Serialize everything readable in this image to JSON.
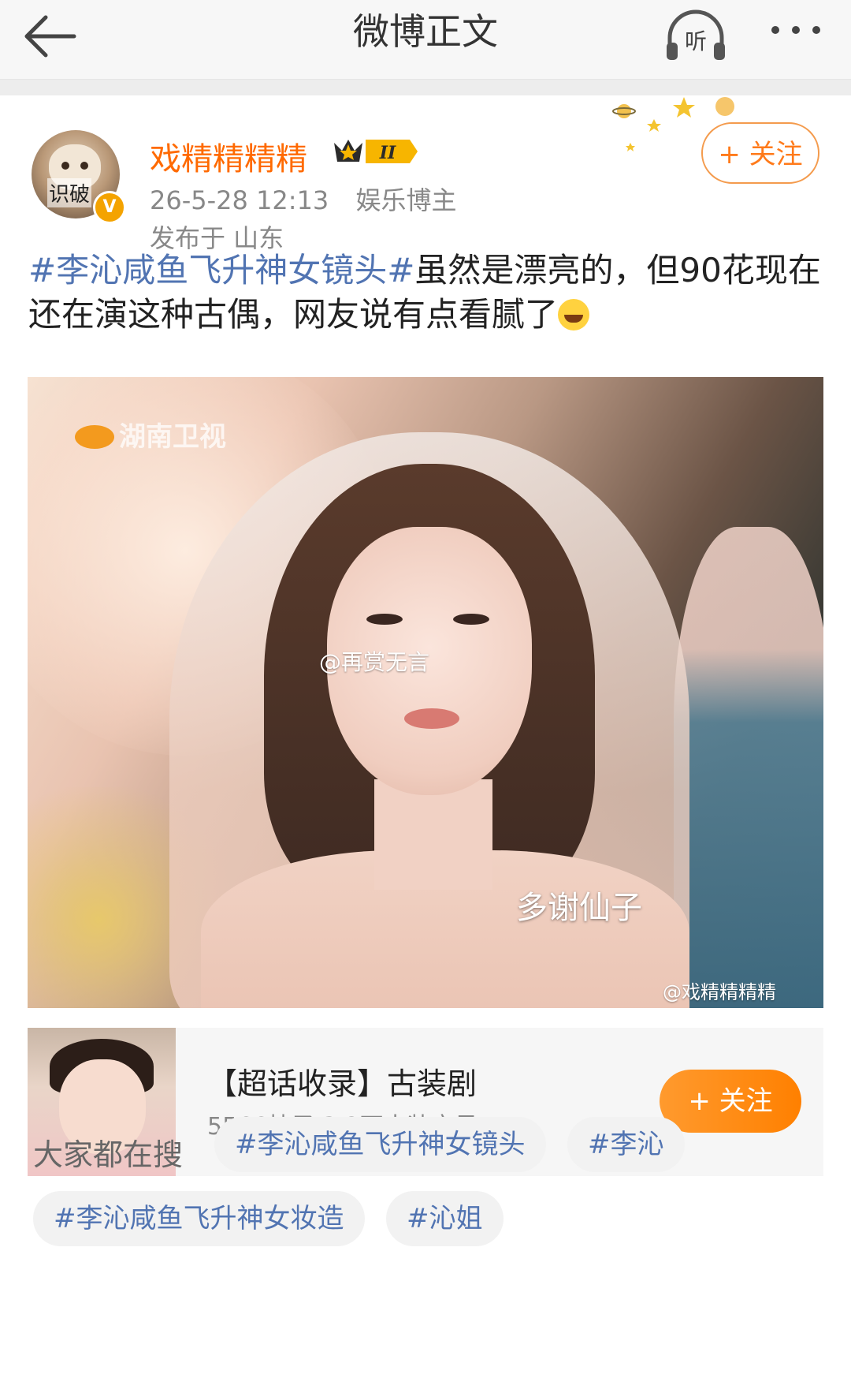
{
  "nav": {
    "title": "微博正文",
    "listen_label": "听"
  },
  "post": {
    "avatar_caption": "识破",
    "username": "戏精精精精",
    "vip_level": "II",
    "timestamp": "26-5-28 12:13",
    "category": "娱乐博主",
    "location": "发布于 山东",
    "follow_label": "+ 关注",
    "text": {
      "hashtag": "#李沁咸鱼飞升神女镜头#",
      "body": "虽然是漂亮的，但90花现在还在演这种古偶，网友说有点看腻了"
    },
    "image": {
      "tv_logo": "湖南卫视",
      "watermark_center": "@再赏无言",
      "subtitle": "多谢仙子",
      "watermark_corner": "@戏精精精精"
    }
  },
  "topic_card": {
    "title": "【超话收录】古装剧",
    "stats": "5566帖子 3.2万古装宝贝",
    "follow_label": "+ 关注"
  },
  "trending": {
    "label": "大家都在搜",
    "chips": [
      "#李沁咸鱼飞升神女镜头",
      "#李沁",
      "#李沁咸鱼飞升神女妆造",
      "#沁姐"
    ]
  },
  "colors": {
    "accent_orange": "#ff7a1a",
    "hashtag_blue": "#5174b2",
    "username_orange": "#ff6a00"
  }
}
